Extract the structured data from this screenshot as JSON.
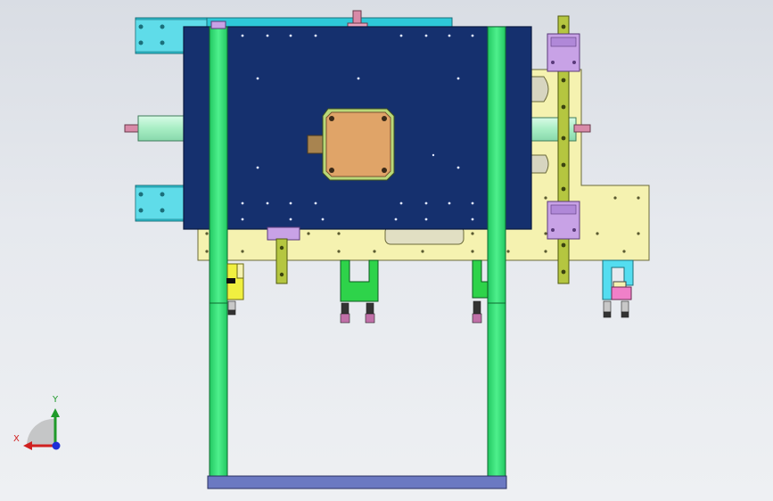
{
  "window": {
    "title": ""
  },
  "viewport": {
    "background_top": "#d9dde4",
    "background_bottom": "#eef0f3",
    "background_mid": "#e6e9ee"
  },
  "colors": {
    "plate": "#15306e",
    "base_plate": "#f5f2b0",
    "rail_cyan": "#2ec8d8",
    "column_green": "#39e07a",
    "guide_rail": "#b5c640",
    "bearing_block": "#c8a2e6",
    "motor": "#e0a468",
    "motor_bezel": "#b9d878",
    "cylinder": "#b4f0c9",
    "bracket_green": "#2ed34a",
    "bracket_yellow": "#f0f040",
    "bracket_cyan": "#54ddf0",
    "sensor_pink": "#f080c8",
    "bottom_bar": "#6b79c2"
  },
  "triad": {
    "x_label": "X",
    "y_label": "Y",
    "x_color": "#d02020",
    "y_color": "#1f9a2a",
    "z_color": "#1d2fd8"
  }
}
